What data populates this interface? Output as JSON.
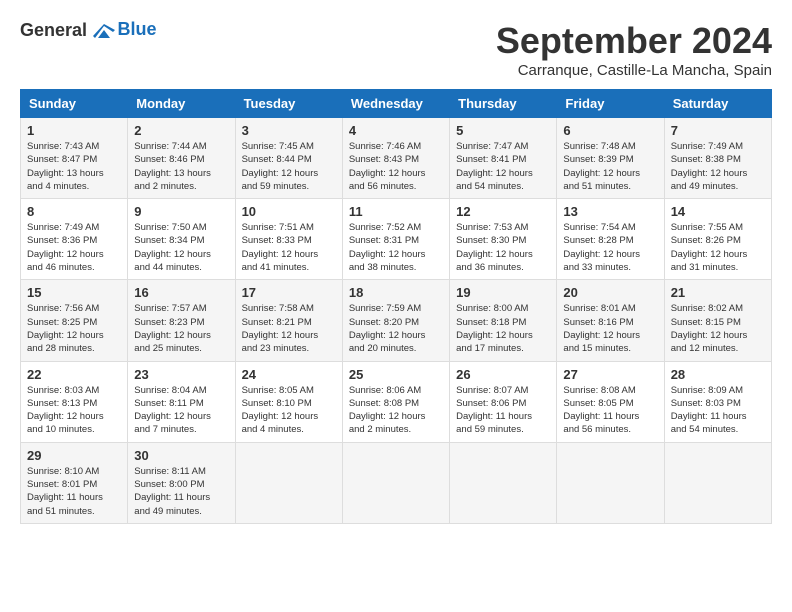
{
  "header": {
    "logo_general": "General",
    "logo_blue": "Blue",
    "month_year": "September 2024",
    "location": "Carranque, Castille-La Mancha, Spain"
  },
  "columns": [
    "Sunday",
    "Monday",
    "Tuesday",
    "Wednesday",
    "Thursday",
    "Friday",
    "Saturday"
  ],
  "weeks": [
    [
      {
        "day": "1",
        "sunrise": "Sunrise: 7:43 AM",
        "sunset": "Sunset: 8:47 PM",
        "daylight": "Daylight: 13 hours and 4 minutes."
      },
      {
        "day": "2",
        "sunrise": "Sunrise: 7:44 AM",
        "sunset": "Sunset: 8:46 PM",
        "daylight": "Daylight: 13 hours and 2 minutes."
      },
      {
        "day": "3",
        "sunrise": "Sunrise: 7:45 AM",
        "sunset": "Sunset: 8:44 PM",
        "daylight": "Daylight: 12 hours and 59 minutes."
      },
      {
        "day": "4",
        "sunrise": "Sunrise: 7:46 AM",
        "sunset": "Sunset: 8:43 PM",
        "daylight": "Daylight: 12 hours and 56 minutes."
      },
      {
        "day": "5",
        "sunrise": "Sunrise: 7:47 AM",
        "sunset": "Sunset: 8:41 PM",
        "daylight": "Daylight: 12 hours and 54 minutes."
      },
      {
        "day": "6",
        "sunrise": "Sunrise: 7:48 AM",
        "sunset": "Sunset: 8:39 PM",
        "daylight": "Daylight: 12 hours and 51 minutes."
      },
      {
        "day": "7",
        "sunrise": "Sunrise: 7:49 AM",
        "sunset": "Sunset: 8:38 PM",
        "daylight": "Daylight: 12 hours and 49 minutes."
      }
    ],
    [
      {
        "day": "8",
        "sunrise": "Sunrise: 7:49 AM",
        "sunset": "Sunset: 8:36 PM",
        "daylight": "Daylight: 12 hours and 46 minutes."
      },
      {
        "day": "9",
        "sunrise": "Sunrise: 7:50 AM",
        "sunset": "Sunset: 8:34 PM",
        "daylight": "Daylight: 12 hours and 44 minutes."
      },
      {
        "day": "10",
        "sunrise": "Sunrise: 7:51 AM",
        "sunset": "Sunset: 8:33 PM",
        "daylight": "Daylight: 12 hours and 41 minutes."
      },
      {
        "day": "11",
        "sunrise": "Sunrise: 7:52 AM",
        "sunset": "Sunset: 8:31 PM",
        "daylight": "Daylight: 12 hours and 38 minutes."
      },
      {
        "day": "12",
        "sunrise": "Sunrise: 7:53 AM",
        "sunset": "Sunset: 8:30 PM",
        "daylight": "Daylight: 12 hours and 36 minutes."
      },
      {
        "day": "13",
        "sunrise": "Sunrise: 7:54 AM",
        "sunset": "Sunset: 8:28 PM",
        "daylight": "Daylight: 12 hours and 33 minutes."
      },
      {
        "day": "14",
        "sunrise": "Sunrise: 7:55 AM",
        "sunset": "Sunset: 8:26 PM",
        "daylight": "Daylight: 12 hours and 31 minutes."
      }
    ],
    [
      {
        "day": "15",
        "sunrise": "Sunrise: 7:56 AM",
        "sunset": "Sunset: 8:25 PM",
        "daylight": "Daylight: 12 hours and 28 minutes."
      },
      {
        "day": "16",
        "sunrise": "Sunrise: 7:57 AM",
        "sunset": "Sunset: 8:23 PM",
        "daylight": "Daylight: 12 hours and 25 minutes."
      },
      {
        "day": "17",
        "sunrise": "Sunrise: 7:58 AM",
        "sunset": "Sunset: 8:21 PM",
        "daylight": "Daylight: 12 hours and 23 minutes."
      },
      {
        "day": "18",
        "sunrise": "Sunrise: 7:59 AM",
        "sunset": "Sunset: 8:20 PM",
        "daylight": "Daylight: 12 hours and 20 minutes."
      },
      {
        "day": "19",
        "sunrise": "Sunrise: 8:00 AM",
        "sunset": "Sunset: 8:18 PM",
        "daylight": "Daylight: 12 hours and 17 minutes."
      },
      {
        "day": "20",
        "sunrise": "Sunrise: 8:01 AM",
        "sunset": "Sunset: 8:16 PM",
        "daylight": "Daylight: 12 hours and 15 minutes."
      },
      {
        "day": "21",
        "sunrise": "Sunrise: 8:02 AM",
        "sunset": "Sunset: 8:15 PM",
        "daylight": "Daylight: 12 hours and 12 minutes."
      }
    ],
    [
      {
        "day": "22",
        "sunrise": "Sunrise: 8:03 AM",
        "sunset": "Sunset: 8:13 PM",
        "daylight": "Daylight: 12 hours and 10 minutes."
      },
      {
        "day": "23",
        "sunrise": "Sunrise: 8:04 AM",
        "sunset": "Sunset: 8:11 PM",
        "daylight": "Daylight: 12 hours and 7 minutes."
      },
      {
        "day": "24",
        "sunrise": "Sunrise: 8:05 AM",
        "sunset": "Sunset: 8:10 PM",
        "daylight": "Daylight: 12 hours and 4 minutes."
      },
      {
        "day": "25",
        "sunrise": "Sunrise: 8:06 AM",
        "sunset": "Sunset: 8:08 PM",
        "daylight": "Daylight: 12 hours and 2 minutes."
      },
      {
        "day": "26",
        "sunrise": "Sunrise: 8:07 AM",
        "sunset": "Sunset: 8:06 PM",
        "daylight": "Daylight: 11 hours and 59 minutes."
      },
      {
        "day": "27",
        "sunrise": "Sunrise: 8:08 AM",
        "sunset": "Sunset: 8:05 PM",
        "daylight": "Daylight: 11 hours and 56 minutes."
      },
      {
        "day": "28",
        "sunrise": "Sunrise: 8:09 AM",
        "sunset": "Sunset: 8:03 PM",
        "daylight": "Daylight: 11 hours and 54 minutes."
      }
    ],
    [
      {
        "day": "29",
        "sunrise": "Sunrise: 8:10 AM",
        "sunset": "Sunset: 8:01 PM",
        "daylight": "Daylight: 11 hours and 51 minutes."
      },
      {
        "day": "30",
        "sunrise": "Sunrise: 8:11 AM",
        "sunset": "Sunset: 8:00 PM",
        "daylight": "Daylight: 11 hours and 49 minutes."
      },
      null,
      null,
      null,
      null,
      null
    ]
  ]
}
